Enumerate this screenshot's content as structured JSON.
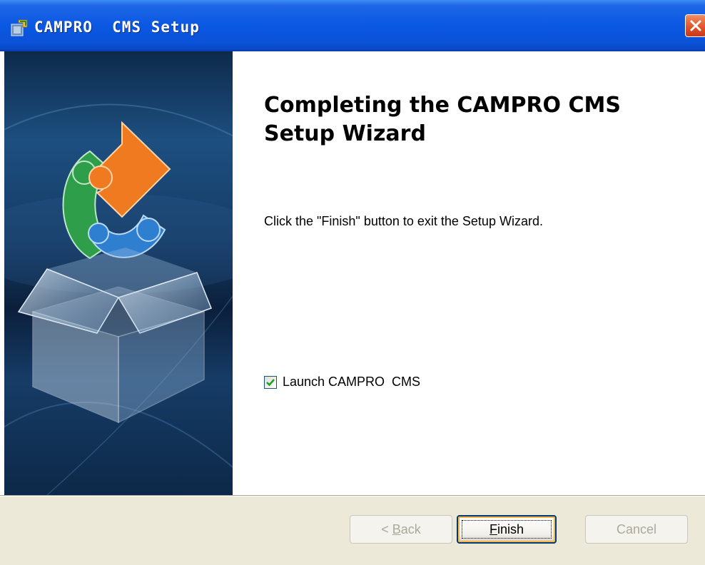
{
  "window": {
    "title": "CAMPRO  CMS Setup",
    "icon": "installer-icon",
    "close_icon": "close-icon"
  },
  "wizard": {
    "heading": "Completing the CAMPRO  CMS Setup Wizard",
    "description": "Click the \"Finish\" button to exit the Setup Wizard.",
    "launch_option": {
      "label": "Launch CAMPRO  CMS",
      "checked": true
    }
  },
  "buttons": {
    "back": {
      "prefix": "< ",
      "mnemonic": "B",
      "rest": "ack",
      "enabled": false
    },
    "finish": {
      "mnemonic": "F",
      "rest": "inish",
      "enabled": true
    },
    "cancel": {
      "label": "Cancel",
      "enabled": false
    }
  },
  "colors": {
    "titlebar": "#0a52d8",
    "dialog_background": "#ece9d8",
    "close_button": "#e0502a",
    "checkmark": "#21a121"
  }
}
